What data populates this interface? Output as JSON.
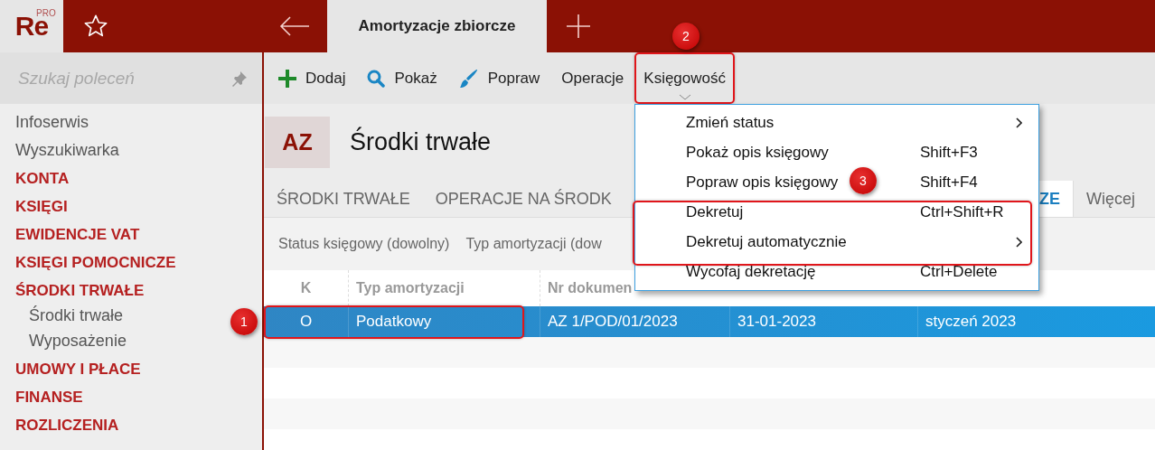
{
  "app": {
    "logo": "Re",
    "logo_badge": "PRO"
  },
  "tabs": [
    {
      "label": "Amortyzacje zbiorcze",
      "selected": true
    }
  ],
  "sidebar": {
    "search_placeholder": "Szukaj poleceń",
    "items": [
      {
        "label": "Infoserwis",
        "kind": "link"
      },
      {
        "label": "Wyszukiwarka",
        "kind": "link"
      },
      {
        "label": "KONTA",
        "kind": "section"
      },
      {
        "label": "KSIĘGI",
        "kind": "section"
      },
      {
        "label": "EWIDENCJE VAT",
        "kind": "section"
      },
      {
        "label": "KSIĘGI POMOCNICZE",
        "kind": "section"
      },
      {
        "label": "ŚRODKI TRWAŁE",
        "kind": "section",
        "children": [
          {
            "label": "Środki trwałe"
          },
          {
            "label": "Wyposażenie"
          }
        ]
      },
      {
        "label": "UMOWY I PŁACE",
        "kind": "section"
      },
      {
        "label": "FINANSE",
        "kind": "section"
      },
      {
        "label": "ROZLICZENIA",
        "kind": "section"
      }
    ]
  },
  "toolbar": [
    {
      "label": "Dodaj",
      "kind": "add"
    },
    {
      "label": "Pokaż",
      "kind": "show"
    },
    {
      "label": "Popraw",
      "kind": "edit"
    },
    {
      "label": "Operacje",
      "kind": "plain"
    },
    {
      "label": "Księgowość",
      "kind": "dropdown",
      "expanded": true
    }
  ],
  "document": {
    "code": "AZ",
    "title": "Środki trwałe"
  },
  "subtabs": [
    {
      "label": "ŚRODKI TRWAŁE",
      "selected": false
    },
    {
      "label": "OPERACJE NA ŚRODK",
      "selected": false
    },
    {
      "label": "ZE",
      "selected": true
    },
    {
      "label": "Więcej",
      "selected": false
    }
  ],
  "filters": [
    "Status księgowy (dowolny)",
    "Typ amortyzacji (dow"
  ],
  "table": {
    "columns": [
      "K",
      "Typ amortyzacji",
      "Nr dokumen"
    ],
    "rows": [
      {
        "cells": [
          "O",
          "Podatkowy",
          "AZ 1/POD/01/2023",
          "31-01-2023",
          "styczeń 2023"
        ],
        "selected": true
      }
    ]
  },
  "menu": {
    "items": [
      {
        "label": "Zmień status",
        "submenu": true
      },
      {
        "label": "Pokaż opis księgowy",
        "shortcut": "Shift+F3",
        "submenu": false
      },
      {
        "label": "Popraw opis księgowy",
        "shortcut": "Shift+F4",
        "submenu": false
      },
      {
        "label": "Dekretuj",
        "shortcut": "Ctrl+Shift+R",
        "submenu": false
      },
      {
        "label": "Dekretuj automatycznie",
        "submenu": true
      },
      {
        "label": "Wycofaj dekretację",
        "shortcut": "Ctrl+Delete",
        "submenu": false
      }
    ]
  },
  "callouts": [
    {
      "number": "1"
    },
    {
      "number": "2"
    },
    {
      "number": "3"
    }
  ]
}
